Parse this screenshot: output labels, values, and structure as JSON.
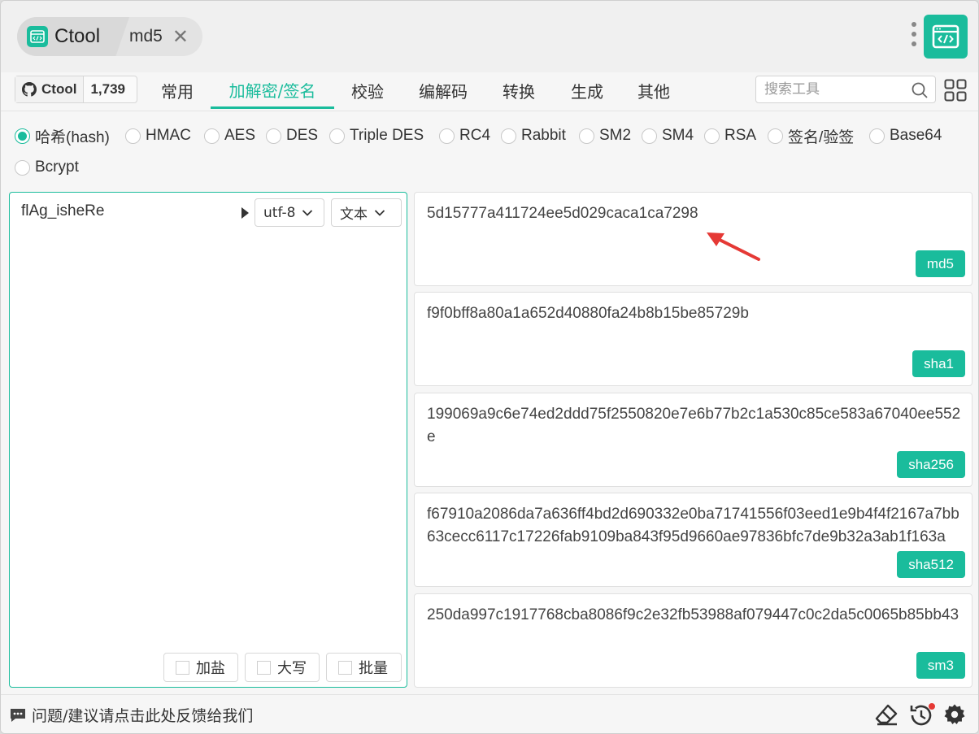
{
  "titlebar": {
    "app_tab": "Ctool",
    "active_tab": "md5"
  },
  "github": {
    "label": "Ctool",
    "stars": "1,739"
  },
  "nav": {
    "items": [
      "常用",
      "加解密/签名",
      "校验",
      "编解码",
      "转换",
      "生成",
      "其他"
    ],
    "active": "加解密/签名",
    "search_placeholder": "搜索工具"
  },
  "algorithms": {
    "options": [
      "哈希(hash)",
      "HMAC",
      "AES",
      "DES",
      "Triple DES",
      "RC4",
      "Rabbit",
      "SM2",
      "SM4",
      "RSA",
      "签名/验签",
      "Base64",
      "Bcrypt"
    ],
    "selected": "哈希(hash)"
  },
  "input": {
    "value": "flAg_isheRe",
    "encoding": "utf-8",
    "format": "文本",
    "options": [
      "加盐",
      "大写",
      "批量"
    ]
  },
  "results": [
    {
      "value": "5d15777a411724ee5d029caca1ca7298",
      "tag": "md5"
    },
    {
      "value": "f9f0bff8a80a1a652d40880fa24b8b15be85729b",
      "tag": "sha1"
    },
    {
      "value": "199069a9c6e74ed2ddd75f2550820e7e6b77b2c1a530c85ce583a67040ee552e",
      "tag": "sha256"
    },
    {
      "value": "f67910a2086da7a636ff4bd2d690332e0ba71741556f03eed1e9b4f4f2167a7bb63cecc6117c17226fab9109ba843f95d9660ae97836bfc7de9b32a3ab1f163a",
      "tag": "sha512"
    },
    {
      "value": "250da997c1917768cba8086f9c2e32fb53988af079447c0c2da5c0065b85bb43",
      "tag": "sm3"
    }
  ],
  "footer": {
    "feedback": "问题/建议请点击此处反馈给我们"
  },
  "colors": {
    "accent": "#1abc9c",
    "annotation_arrow": "#e53935"
  }
}
